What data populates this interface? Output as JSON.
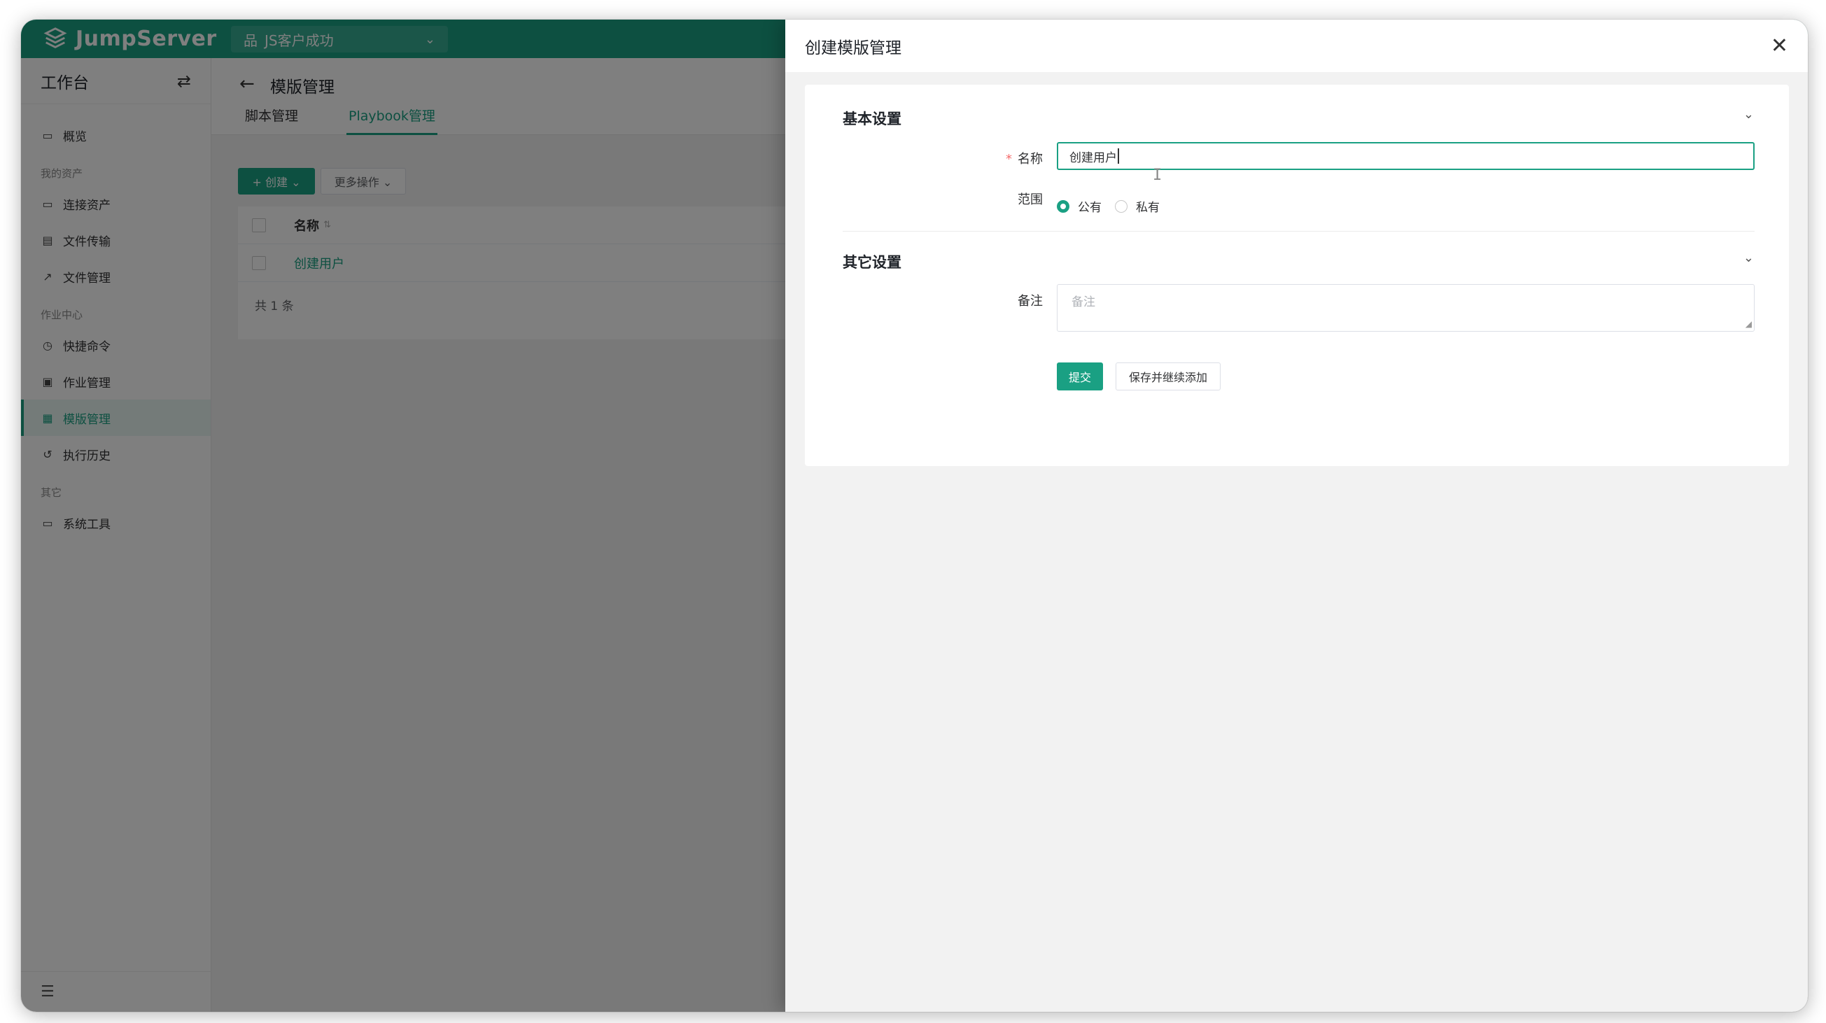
{
  "navbar": {
    "brand": "JumpServer",
    "org_label": "JS客户成功",
    "org_icon": "org-tree-icon"
  },
  "sidebar": {
    "title": "工作台",
    "groups": [
      {
        "label": ""
      },
      {
        "label": "我的资产"
      },
      {
        "label": "作业中心"
      },
      {
        "label": "其它"
      }
    ],
    "items": [
      {
        "label": "概览",
        "icon": "dashboard-icon"
      },
      {
        "label": "连接资产",
        "icon": "monitor-icon"
      },
      {
        "label": "文件传输",
        "icon": "file-icon"
      },
      {
        "label": "文件管理",
        "icon": "external-link-icon"
      },
      {
        "label": "快捷命令",
        "icon": "command-icon"
      },
      {
        "label": "作业管理",
        "icon": "calendar-icon"
      },
      {
        "label": "模版管理",
        "icon": "template-icon",
        "active": true
      },
      {
        "label": "执行历史",
        "icon": "history-icon"
      },
      {
        "label": "系统工具",
        "icon": "toolbox-icon"
      }
    ]
  },
  "page": {
    "title": "模版管理",
    "tabs": [
      {
        "label": "脚本管理"
      },
      {
        "label": "Playbook管理",
        "active": true
      }
    ],
    "create_label": "+ 创建 ⌄",
    "more_label": "更多操作 ⌄",
    "table": {
      "header_name": "名称",
      "rows": [
        {
          "name": "创建用户"
        }
      ],
      "footer": "共 1 条"
    }
  },
  "drawer": {
    "title": "创建模版管理",
    "basic_section": "基本设置",
    "name_label": "名称",
    "name_value": "创建用户",
    "scope_label": "范围",
    "scope_options": [
      {
        "label": "公有",
        "selected": true
      },
      {
        "label": "私有",
        "selected": false
      }
    ],
    "other_section": "其它设置",
    "remark_label": "备注",
    "remark_placeholder": "备注",
    "submit_label": "提交",
    "save_add_label": "保存并继续添加"
  },
  "colors": {
    "primary": "#1aa083",
    "overlay": "rgba(0,0,0,0.5)"
  }
}
